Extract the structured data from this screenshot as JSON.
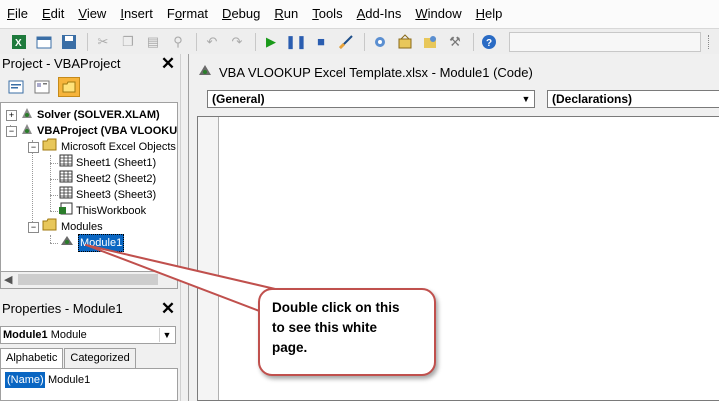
{
  "menu": [
    "File",
    "Edit",
    "View",
    "Insert",
    "Format",
    "Debug",
    "Run",
    "Tools",
    "Add-Ins",
    "Window",
    "Help"
  ],
  "menu_underline": [
    "F",
    "E",
    "V",
    "I",
    "o",
    "D",
    "R",
    "T",
    "A",
    "W",
    "H"
  ],
  "project_panel": {
    "title": "Project - VBAProject",
    "close": "✕",
    "tree": [
      {
        "label": "Solver (SOLVER.XLAM)",
        "bold": true
      },
      {
        "label": "VBAProject (VBA VLOOKU",
        "bold": true
      },
      {
        "label": "Microsoft Excel Objects",
        "bold": false
      },
      {
        "label": "Sheet1 (Sheet1)",
        "bold": false
      },
      {
        "label": "Sheet2 (Sheet2)",
        "bold": false
      },
      {
        "label": "Sheet3 (Sheet3)",
        "bold": false
      },
      {
        "label": "ThisWorkbook",
        "bold": false
      },
      {
        "label": "Modules",
        "bold": false
      },
      {
        "label": "Module1",
        "bold": false,
        "selected": true
      }
    ]
  },
  "properties_panel": {
    "title": "Properties - Module1",
    "close": "✕",
    "object_name": "Module1",
    "object_type": "Module",
    "tabs": [
      "Alphabetic",
      "Categorized"
    ],
    "active_tab": "Alphabetic",
    "property": {
      "name": "(Name)",
      "value": "Module1"
    }
  },
  "code_window": {
    "title": "VBA VLOOKUP Excel Template.xlsx - Module1 (Code)",
    "object_combo": "(General)",
    "procedure_combo": "(Declarations)"
  },
  "callout": {
    "text": "Double click on this to see this white page.",
    "lines": [
      "Double click on this",
      "to see this white",
      "page."
    ]
  },
  "colors": {
    "selection": "#0a66c2",
    "callout_border": "#c0504d",
    "folder": "#e8c75a"
  }
}
